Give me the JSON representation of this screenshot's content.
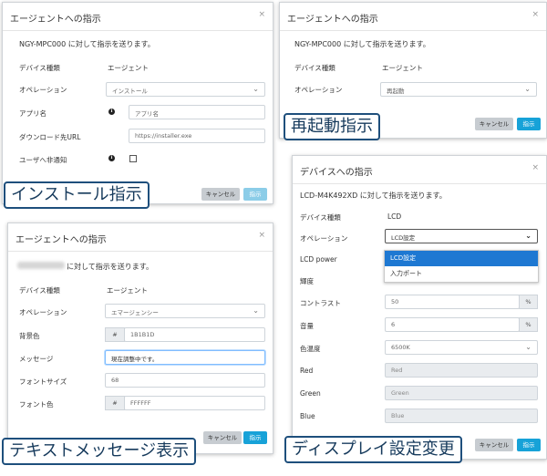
{
  "common": {
    "close_glyph": "×",
    "label_device_type": "デバイス種類",
    "label_operation": "オペレーション",
    "btn_cancel": "キャンセル",
    "btn_submit": "指示",
    "chevron": "⌄"
  },
  "install": {
    "title": "エージェントへの指示",
    "description": "NGY-MPC000 に対して指示を送ります。",
    "device_type": "エージェント",
    "operation": "インストール",
    "label_app_name": "アプリ名",
    "app_name_placeholder": "アプリ名",
    "label_download_url": "ダウンロード先URL",
    "download_url_placeholder": "https://installer.exe",
    "label_notify": "ユーザへ非通知",
    "caption": "インストール指示"
  },
  "restart": {
    "title": "エージェントへの指示",
    "description": "NGY-MPC000 に対して指示を送ります。",
    "device_type": "エージェント",
    "operation": "再起動",
    "caption": "再起動指示"
  },
  "message": {
    "title": "エージェントへの指示",
    "description": "に対して指示を送ります。",
    "device_type": "エージェント",
    "operation": "エマージェンシー",
    "label_bg": "背景色",
    "bg_value": "1B1B1D",
    "label_message": "メッセージ",
    "message_value": "現在調整中です。",
    "label_font_size": "フォントサイズ",
    "font_size_value": "68",
    "label_font_color": "フォント色",
    "font_color_value": "FFFFFF",
    "hash": "#",
    "caption": "テキストメッセージ表示"
  },
  "display": {
    "title": "デバイスへの指示",
    "description": "LCD-M4K492XD に対して指示を送ります。",
    "device_type": "LCD",
    "operation": "LCD設定",
    "dropdown_options": [
      "LCD設定",
      "入力ポート"
    ],
    "label_power": "LCD power",
    "label_brightness": "輝度",
    "label_contrast": "コントラスト",
    "contrast_value": "50",
    "label_volume": "音量",
    "volume_value": "6",
    "percent": "%",
    "label_color_temp": "色温度",
    "color_temp_value": "6500K",
    "label_red": "Red",
    "red_placeholder": "Red",
    "label_green": "Green",
    "green_placeholder": "Green",
    "label_blue": "Blue",
    "blue_placeholder": "Blue",
    "caption": "ディスプレイ設定変更"
  }
}
